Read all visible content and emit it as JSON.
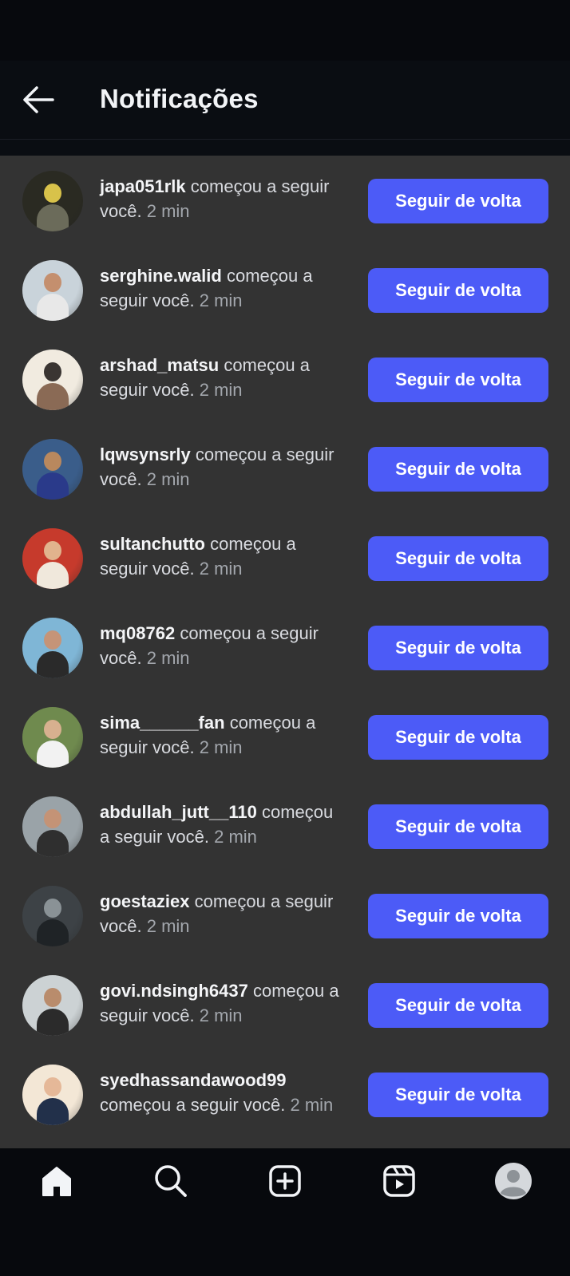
{
  "header": {
    "title": "Notificações"
  },
  "notifications": [
    {
      "username": "japa051rlk",
      "action": "começou a seguir você.",
      "time": "2 min",
      "button_label": "Seguir de volta",
      "avatar_colors": [
        "#2a2a22",
        "#d8c24a",
        "#6b6b5a"
      ]
    },
    {
      "username": "serghine.walid",
      "action": "começou a seguir você.",
      "time": "2 min",
      "button_label": "Seguir de volta",
      "avatar_colors": [
        "#c9d3da",
        "#c48f6e",
        "#e8e8e8"
      ]
    },
    {
      "username": "arshad_matsu",
      "action": "começou a seguir você.",
      "time": "2 min",
      "button_label": "Seguir de volta",
      "avatar_colors": [
        "#f1ebe0",
        "#3a3532",
        "#8a6a55"
      ]
    },
    {
      "username": "lqwsynsrly",
      "action": "começou a seguir você.",
      "time": "2 min",
      "button_label": "Seguir de volta",
      "avatar_colors": [
        "#3a5d8a",
        "#b9885e",
        "#2a3a8a"
      ]
    },
    {
      "username": "sultanchutto",
      "action": "começou a seguir você.",
      "time": "2 min",
      "button_label": "Seguir de volta",
      "avatar_colors": [
        "#c63a2c",
        "#e1b38d",
        "#f0e8dc"
      ]
    },
    {
      "username": "mq08762",
      "action": "começou a seguir você.",
      "time": "2 min",
      "button_label": "Seguir de volta",
      "avatar_colors": [
        "#7fb6d6",
        "#c59478",
        "#2a2a2a"
      ]
    },
    {
      "username": "sima______fan",
      "action": "começou a seguir você.",
      "time": "2 min",
      "button_label": "Seguir de volta",
      "avatar_colors": [
        "#6f8a4e",
        "#d7b08f",
        "#f2f2f2"
      ]
    },
    {
      "username": "abdullah_jutt__110",
      "action": "começou a seguir você.",
      "time": "2 min",
      "button_label": "Seguir de volta",
      "avatar_colors": [
        "#9aa3a8",
        "#c49376",
        "#2f2f2f"
      ]
    },
    {
      "username": "goestaziex",
      "action": "começou a seguir você.",
      "time": "2 min",
      "button_label": "Seguir de volta",
      "avatar_colors": [
        "#3d4246",
        "#8a9296",
        "#1f2326"
      ]
    },
    {
      "username": "govi.ndsingh6437",
      "action": "começou a seguir você.",
      "time": "2 min",
      "button_label": "Seguir de volta",
      "avatar_colors": [
        "#ccd2d4",
        "#b98c6c",
        "#2b2b2b"
      ]
    },
    {
      "username": "syedhassandawood99",
      "action": "começou a seguir você.",
      "time": "2 min",
      "button_label": "Seguir de volta",
      "avatar_colors": [
        "#f3e7d6",
        "#e5b898",
        "#22304a"
      ]
    }
  ],
  "tabbar": {
    "items": [
      {
        "name": "home",
        "icon": "home-icon",
        "active": true
      },
      {
        "name": "search",
        "icon": "search-icon"
      },
      {
        "name": "create",
        "icon": "plus-square-icon"
      },
      {
        "name": "reels",
        "icon": "reels-icon"
      },
      {
        "name": "profile",
        "icon": "profile-avatar-icon"
      }
    ]
  },
  "colors": {
    "accent": "#4c5bf7",
    "list_bg": "#333333",
    "app_bg": "#07090d"
  }
}
